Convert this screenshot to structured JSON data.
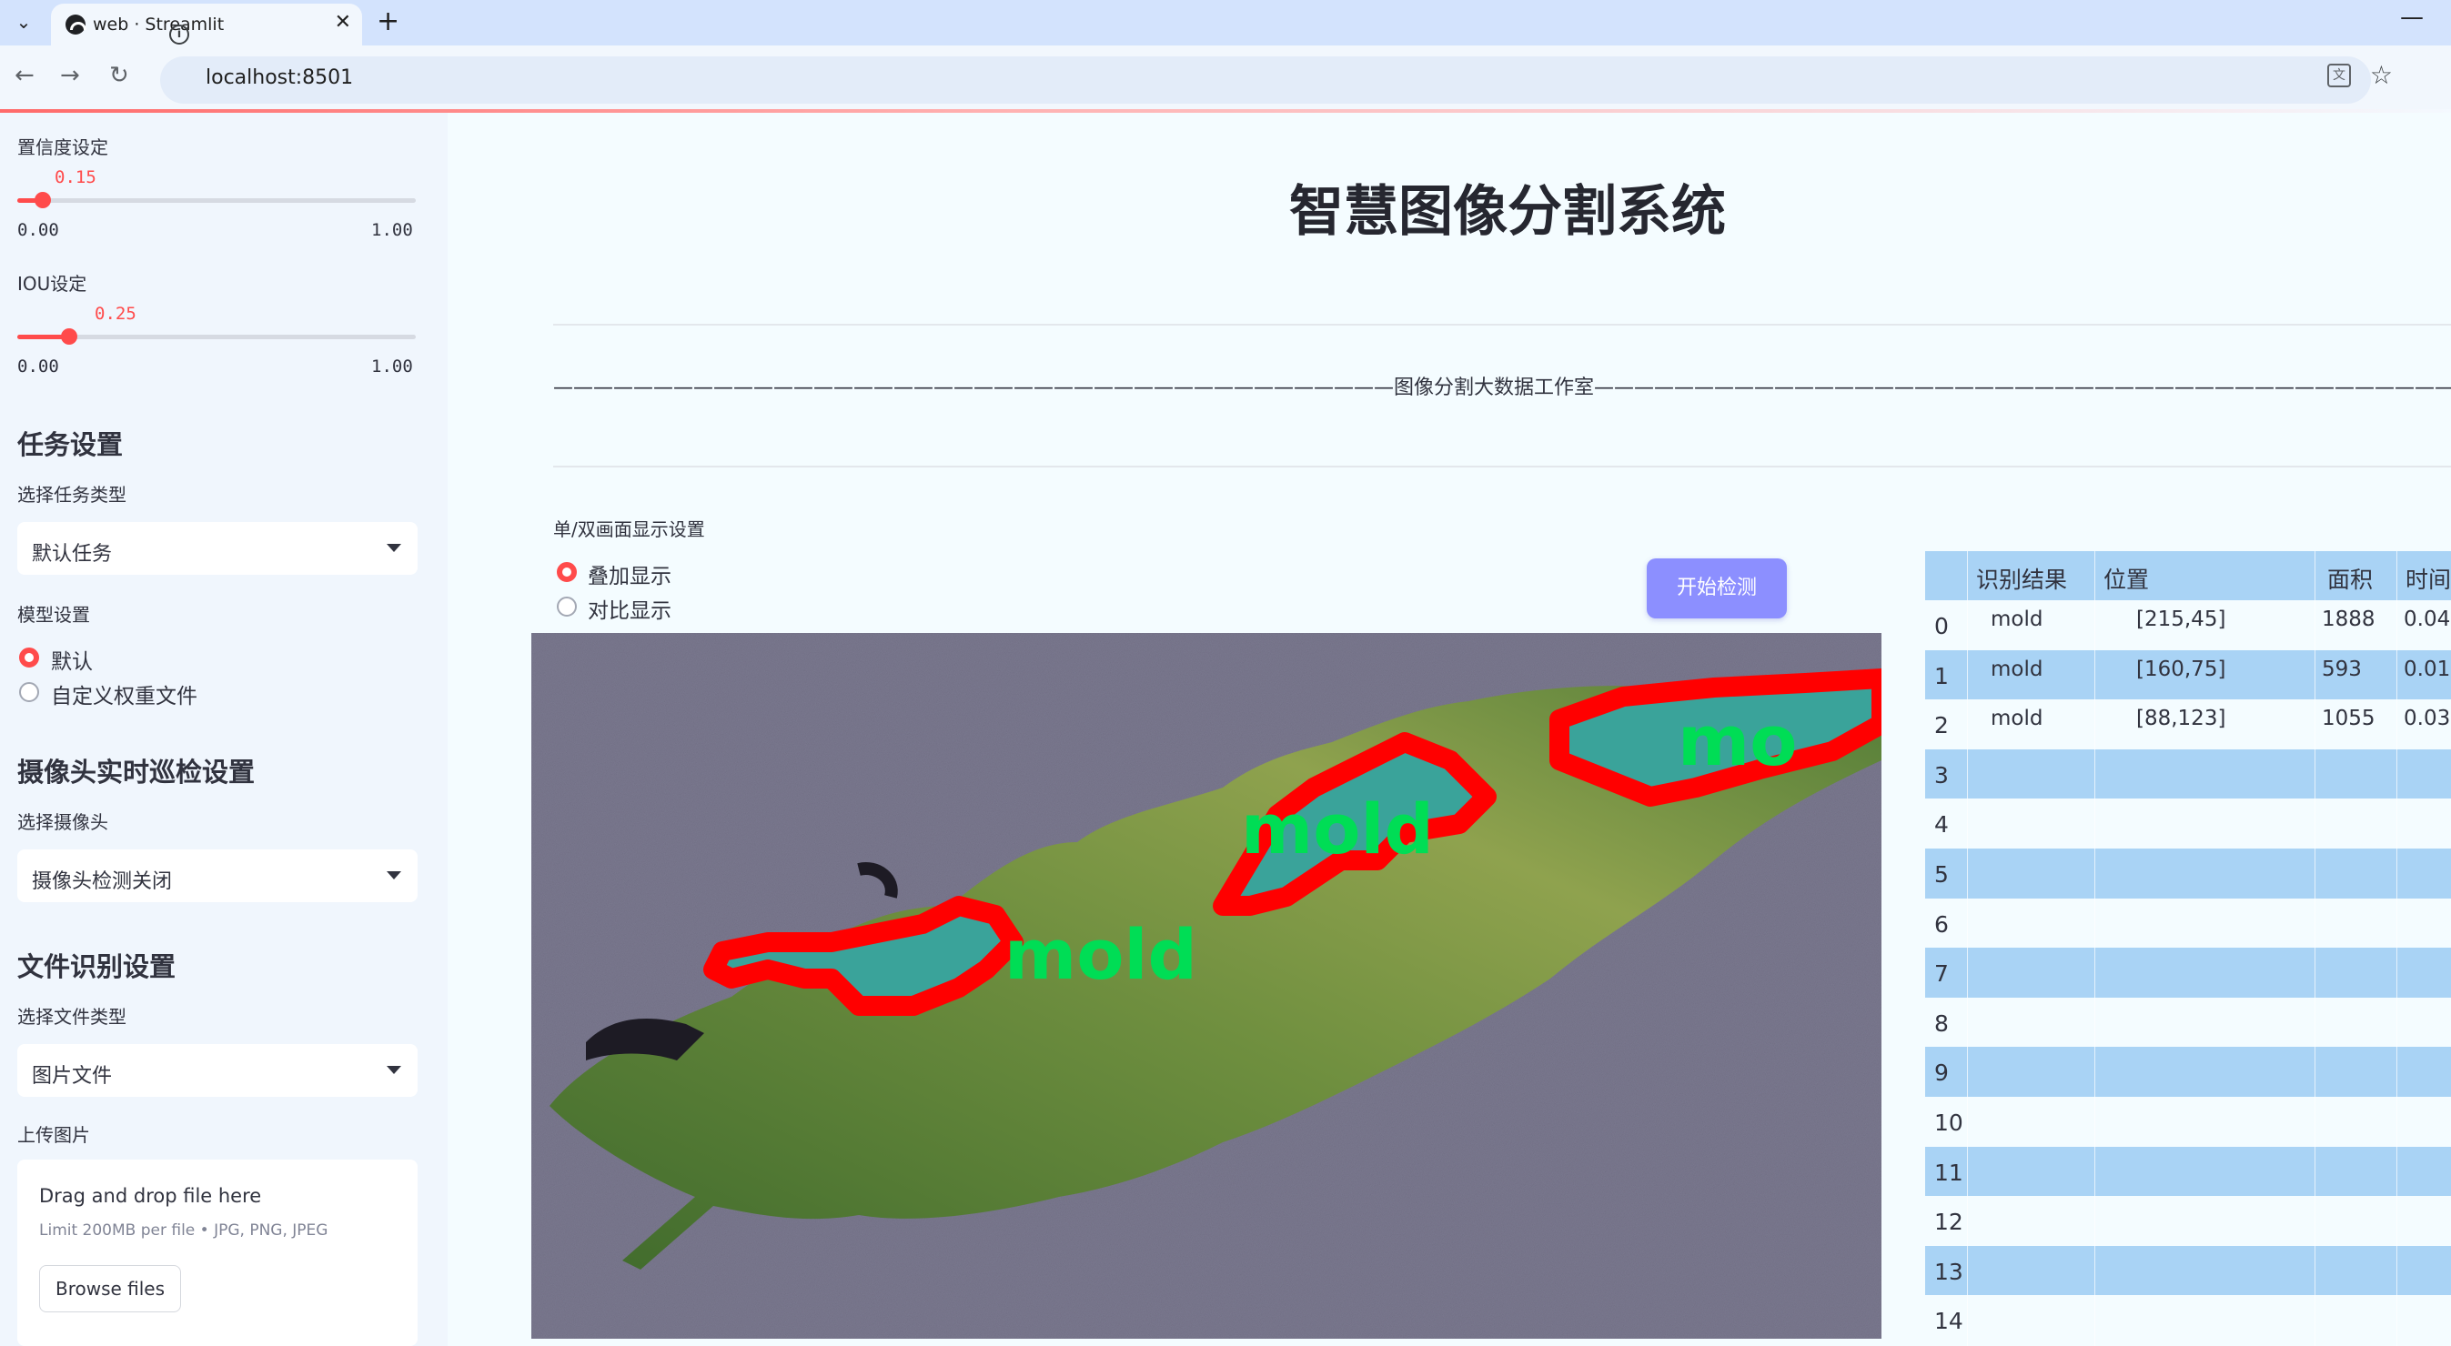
{
  "browser": {
    "tab_title": "web · Streamlit",
    "url": "localhost:8501"
  },
  "sidebar": {
    "confidence": {
      "label": "置信度设定",
      "value": "0.15",
      "min": "0.00",
      "max": "1.00",
      "level": 0.15
    },
    "iou": {
      "label": "IOU设定",
      "value": "0.25",
      "min": "0.00",
      "max": "1.00",
      "level": 0.25
    },
    "task_heading": "任务设置",
    "task_type_label": "选择任务类型",
    "task_type_value": "默认任务",
    "model_label": "模型设置",
    "model_options": [
      "默认",
      "自定义权重文件"
    ],
    "camera_heading": "摄像头实时巡检设置",
    "camera_label": "选择摄像头",
    "camera_value": "摄像头检测关闭",
    "file_heading": "文件识别设置",
    "file_type_label": "选择文件类型",
    "file_type_value": "图片文件",
    "upload_label": "上传图片",
    "upload_drop": "Drag and drop file here",
    "upload_limit": "Limit 200MB per file • JPG, PNG, JPEG",
    "browse_button": "Browse files"
  },
  "main": {
    "title": "智慧图像分割系统",
    "studio_line": "——————————————————————————————————————————图像分割大数据工作室————————————————————————————————————————————————",
    "display_label": "单/双画面显示设置",
    "display_options": [
      "叠加显示",
      "对比显示"
    ],
    "start_button": "开始检测",
    "detection_labels": [
      "mold",
      "mold",
      "mo"
    ]
  },
  "table": {
    "headers": [
      "识别结果",
      "位置",
      "面积",
      "时间"
    ],
    "rows": [
      {
        "idx": "0",
        "label": "mold",
        "pos": "[215,45]",
        "area": "1888",
        "time": "0.04"
      },
      {
        "idx": "1",
        "label": "mold",
        "pos": "[160,75]",
        "area": "593",
        "time": "0.01"
      },
      {
        "idx": "2",
        "label": "mold",
        "pos": "[88,123]",
        "area": "1055",
        "time": "0.03"
      },
      {
        "idx": "3"
      },
      {
        "idx": "4"
      },
      {
        "idx": "5"
      },
      {
        "idx": "6"
      },
      {
        "idx": "7"
      },
      {
        "idx": "8"
      },
      {
        "idx": "9"
      },
      {
        "idx": "10"
      },
      {
        "idx": "11"
      },
      {
        "idx": "12"
      },
      {
        "idx": "13"
      },
      {
        "idx": "14"
      }
    ]
  },
  "colors": {
    "accent": "#ff4b4b",
    "button": "#8c8fff",
    "table_band": "#a9d3f5",
    "seg_outline": "#ff0000",
    "seg_label": "#00dd55"
  }
}
